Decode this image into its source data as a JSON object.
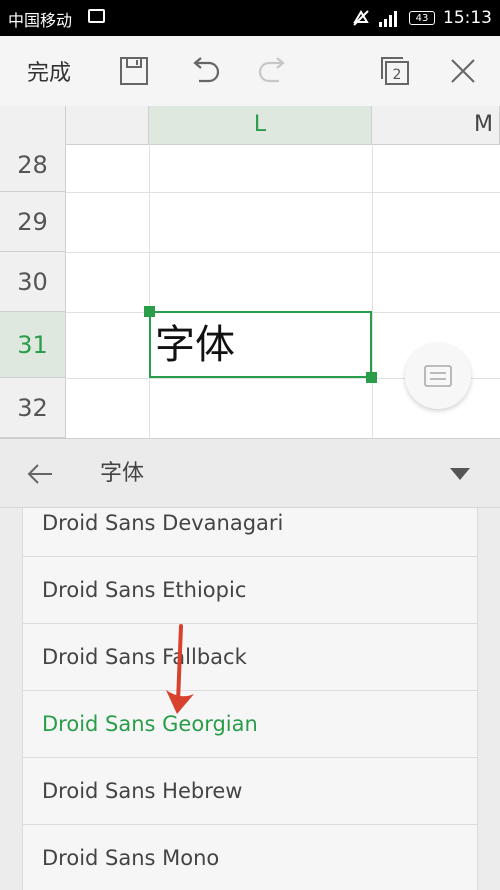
{
  "status_bar": {
    "carrier": "中国移动",
    "battery": "43",
    "time": "15:13"
  },
  "toolbar": {
    "done_label": "完成",
    "tab_count": "2"
  },
  "grid": {
    "columns": [
      "L",
      "M"
    ],
    "rows": [
      "28",
      "29",
      "30",
      "31",
      "32"
    ],
    "selected_column": "L",
    "selected_row": "31",
    "selected_cell_text": "字体"
  },
  "font_panel": {
    "title": "字体",
    "fonts": [
      "Droid Sans Devanagari",
      "Droid Sans Ethiopic",
      "Droid Sans Fallback",
      "Droid Sans Georgian",
      "Droid Sans Hebrew",
      "Droid Sans Mono"
    ],
    "selected_font": "Droid Sans Georgian"
  },
  "colors": {
    "accent": "#2a9d4a",
    "annotation_arrow": "#d9412f"
  },
  "icons": [
    "image-icon",
    "mute-icon",
    "signal-icon",
    "battery-icon",
    "save-icon",
    "undo-icon",
    "redo-icon",
    "tabs-icon",
    "close-icon",
    "keyboard-icon",
    "back-arrow-icon",
    "dropdown-triangle-icon"
  ]
}
